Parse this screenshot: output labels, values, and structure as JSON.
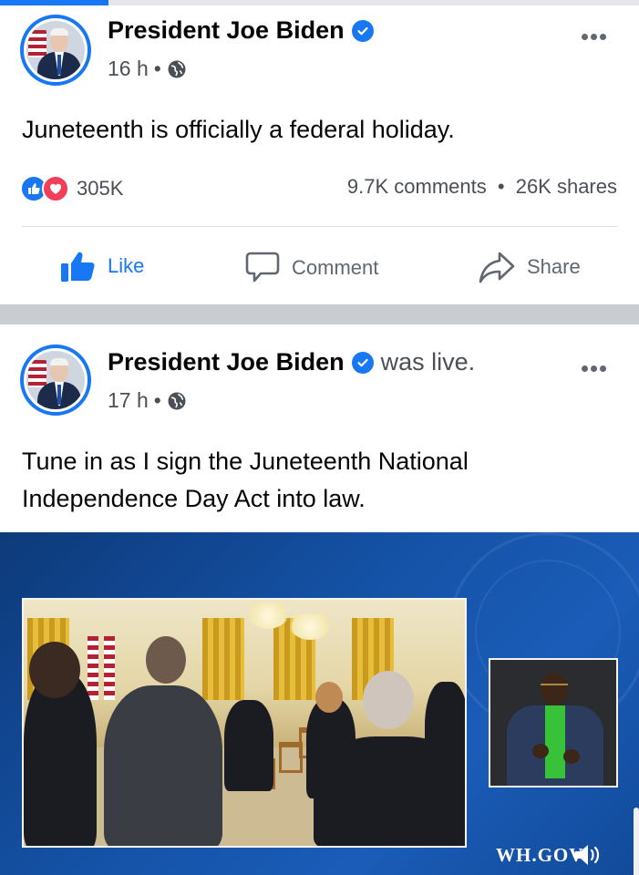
{
  "top_progress": {
    "fraction": 0.17
  },
  "posts": [
    {
      "author": "President Joe Biden",
      "verified": true,
      "status_suffix": "",
      "time": "16 h",
      "separator": "•",
      "privacy_icon": "globe-icon",
      "text": "Juneteenth is officially a federal holiday.",
      "reactions": {
        "icons": [
          "like-reaction-icon",
          "love-reaction-icon"
        ],
        "count": "305K"
      },
      "comments": "9.7K comments",
      "shares": "26K shares",
      "counts_separator": "•",
      "actions": [
        {
          "label": "Like",
          "icon": "thumbs-up-icon",
          "active": true
        },
        {
          "label": "Comment",
          "icon": "comment-bubble-icon"
        },
        {
          "label": "Share",
          "icon": "share-arrow-icon"
        }
      ]
    },
    {
      "author": "President Joe Biden",
      "verified": true,
      "status_suffix": "was live.",
      "time": "17 h",
      "separator": "•",
      "privacy_icon": "globe-icon",
      "text": "Tune in as I sign the Juneteenth National Independence Day Act into law.",
      "video": {
        "watermark": "WH.GOV",
        "muted_icon": "speaker-icon"
      }
    }
  ],
  "colors": {
    "brand_blue": "#1877f2",
    "love_red": "#f33e58",
    "divider_gray": "#c9ccd1",
    "video_blue": "#1553a8"
  }
}
